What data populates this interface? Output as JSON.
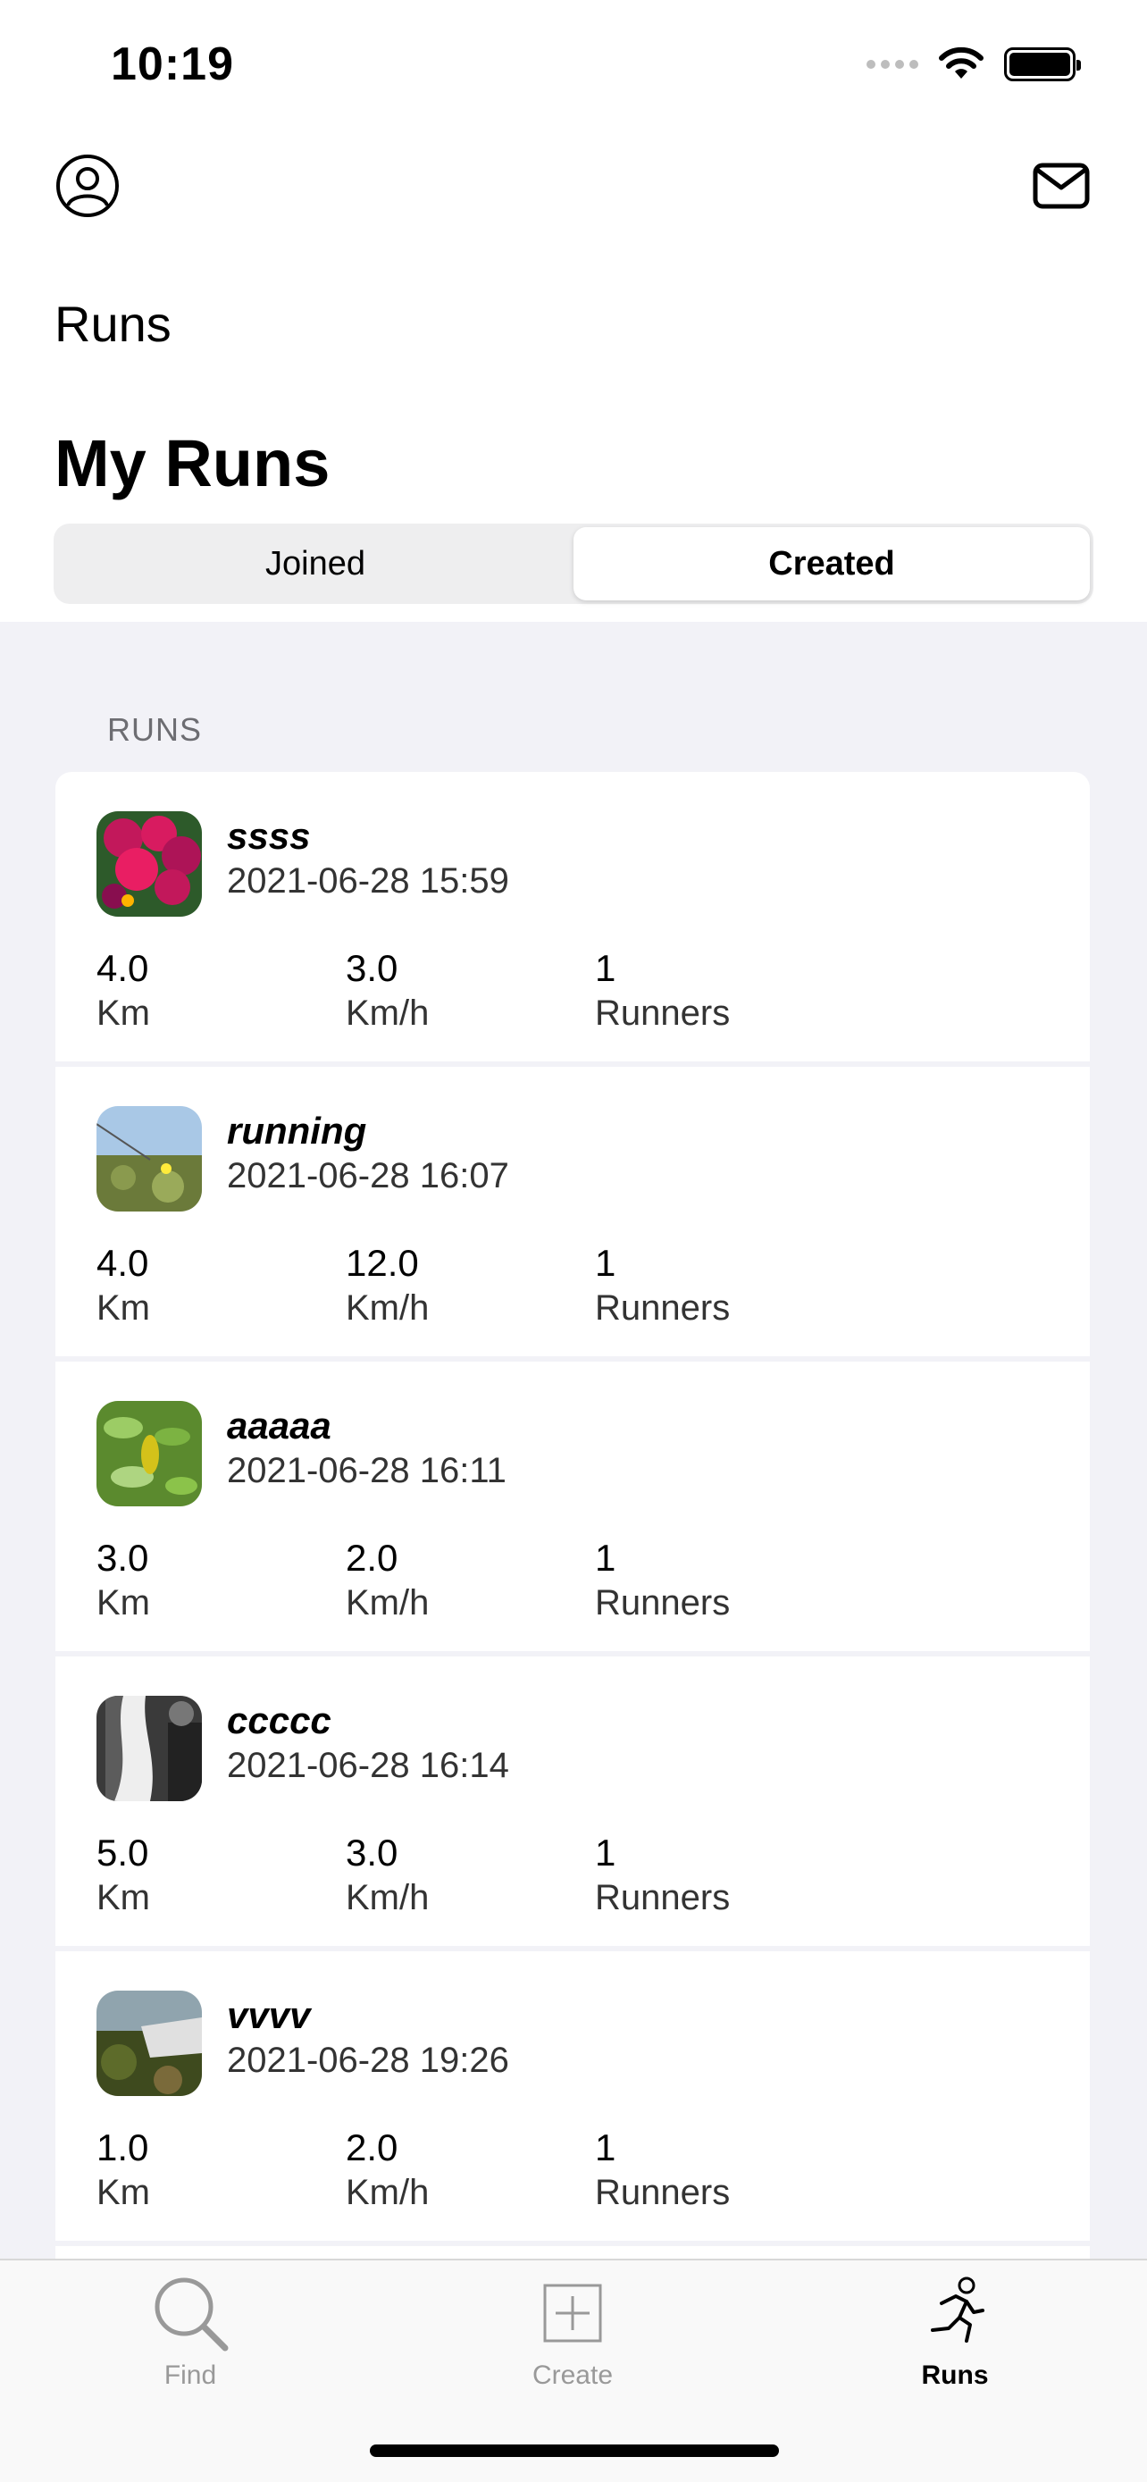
{
  "status": {
    "time": "10:19"
  },
  "header": {
    "nav_title": "Runs",
    "large_title": "My Runs"
  },
  "segments": [
    {
      "label": "Joined",
      "active": false
    },
    {
      "label": "Created",
      "active": true
    }
  ],
  "section_header": "RUNS",
  "runs": [
    {
      "name": "ssss",
      "datetime": "2021-06-28 15:59",
      "distance": "4.0",
      "distance_unit": "Km",
      "speed": "3.0",
      "speed_unit": "Km/h",
      "runners": "1",
      "runners_label": "Runners"
    },
    {
      "name": "running",
      "datetime": "2021-06-28 16:07",
      "distance": "4.0",
      "distance_unit": "Km",
      "speed": "12.0",
      "speed_unit": "Km/h",
      "runners": "1",
      "runners_label": "Runners"
    },
    {
      "name": "aaaaa",
      "datetime": "2021-06-28 16:11",
      "distance": "3.0",
      "distance_unit": "Km",
      "speed": "2.0",
      "speed_unit": "Km/h",
      "runners": "1",
      "runners_label": "Runners"
    },
    {
      "name": "ccccc",
      "datetime": "2021-06-28 16:14",
      "distance": "5.0",
      "distance_unit": "Km",
      "speed": "3.0",
      "speed_unit": "Km/h",
      "runners": "1",
      "runners_label": "Runners"
    },
    {
      "name": "vvvv",
      "datetime": "2021-06-28 19:26",
      "distance": "1.0",
      "distance_unit": "Km",
      "speed": "2.0",
      "speed_unit": "Km/h",
      "runners": "1",
      "runners_label": "Runners"
    }
  ],
  "tabs": [
    {
      "label": "Find",
      "icon": "search-icon",
      "active": false
    },
    {
      "label": "Create",
      "icon": "plus-square-icon",
      "active": false
    },
    {
      "label": "Runs",
      "icon": "runner-icon",
      "active": true
    }
  ]
}
